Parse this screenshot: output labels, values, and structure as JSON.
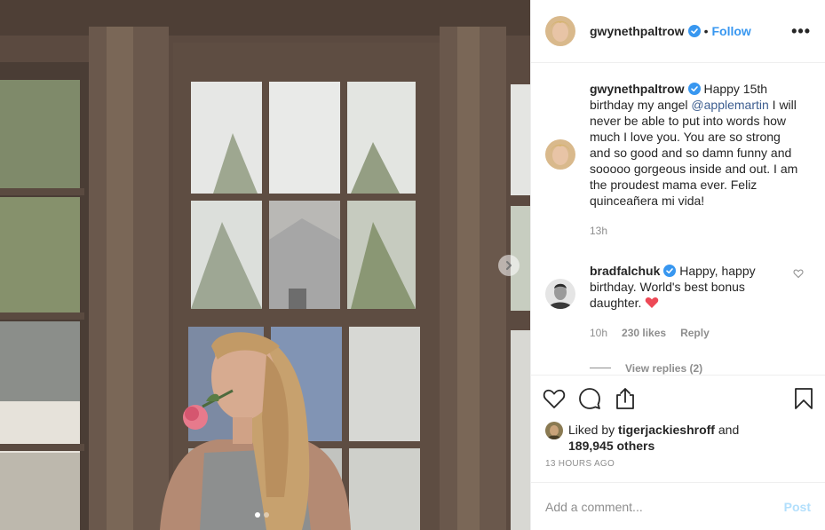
{
  "post": {
    "username": "gwynethpaltrow",
    "follow_separator": "•",
    "follow_label": "Follow",
    "more_label": "•••",
    "carousel_dots": 2
  },
  "caption": {
    "username": "gwynethpaltrow",
    "text_before": "Happy 15th birthday my angel ",
    "mention": "@applemartin",
    "text_after": " I will never be able to put into words how much I love you. You are so strong and so good and so damn funny and sooooo gorgeous inside and out. I am the proudest mama ever. Feliz quinceañera mi vida!",
    "time": "13h"
  },
  "comment": {
    "username": "bradfalchuk",
    "text": "Happy, happy birthday. World's best bonus daughter.",
    "emoji": "❤️",
    "time": "10h",
    "likes": "230 likes",
    "reply_label": "Reply",
    "view_replies": "View replies (2)"
  },
  "likes": {
    "prefix": "Liked by ",
    "user": "tigerjackieshroff",
    "connector": " and",
    "others": "189,945 others"
  },
  "timestamp": "13 HOURS AGO",
  "composer": {
    "placeholder": "Add a comment...",
    "post_label": "Post"
  },
  "icons": [
    "verified-icon",
    "more-icon",
    "next-arrow-icon",
    "heart-icon",
    "comment-icon",
    "share-icon",
    "bookmark-icon",
    "heart-small-icon"
  ],
  "colors": {
    "link_blue": "#3897f0",
    "muted": "#8e8e8e",
    "post_disabled": "#b2dffc",
    "heart_red": "#ed4956"
  }
}
